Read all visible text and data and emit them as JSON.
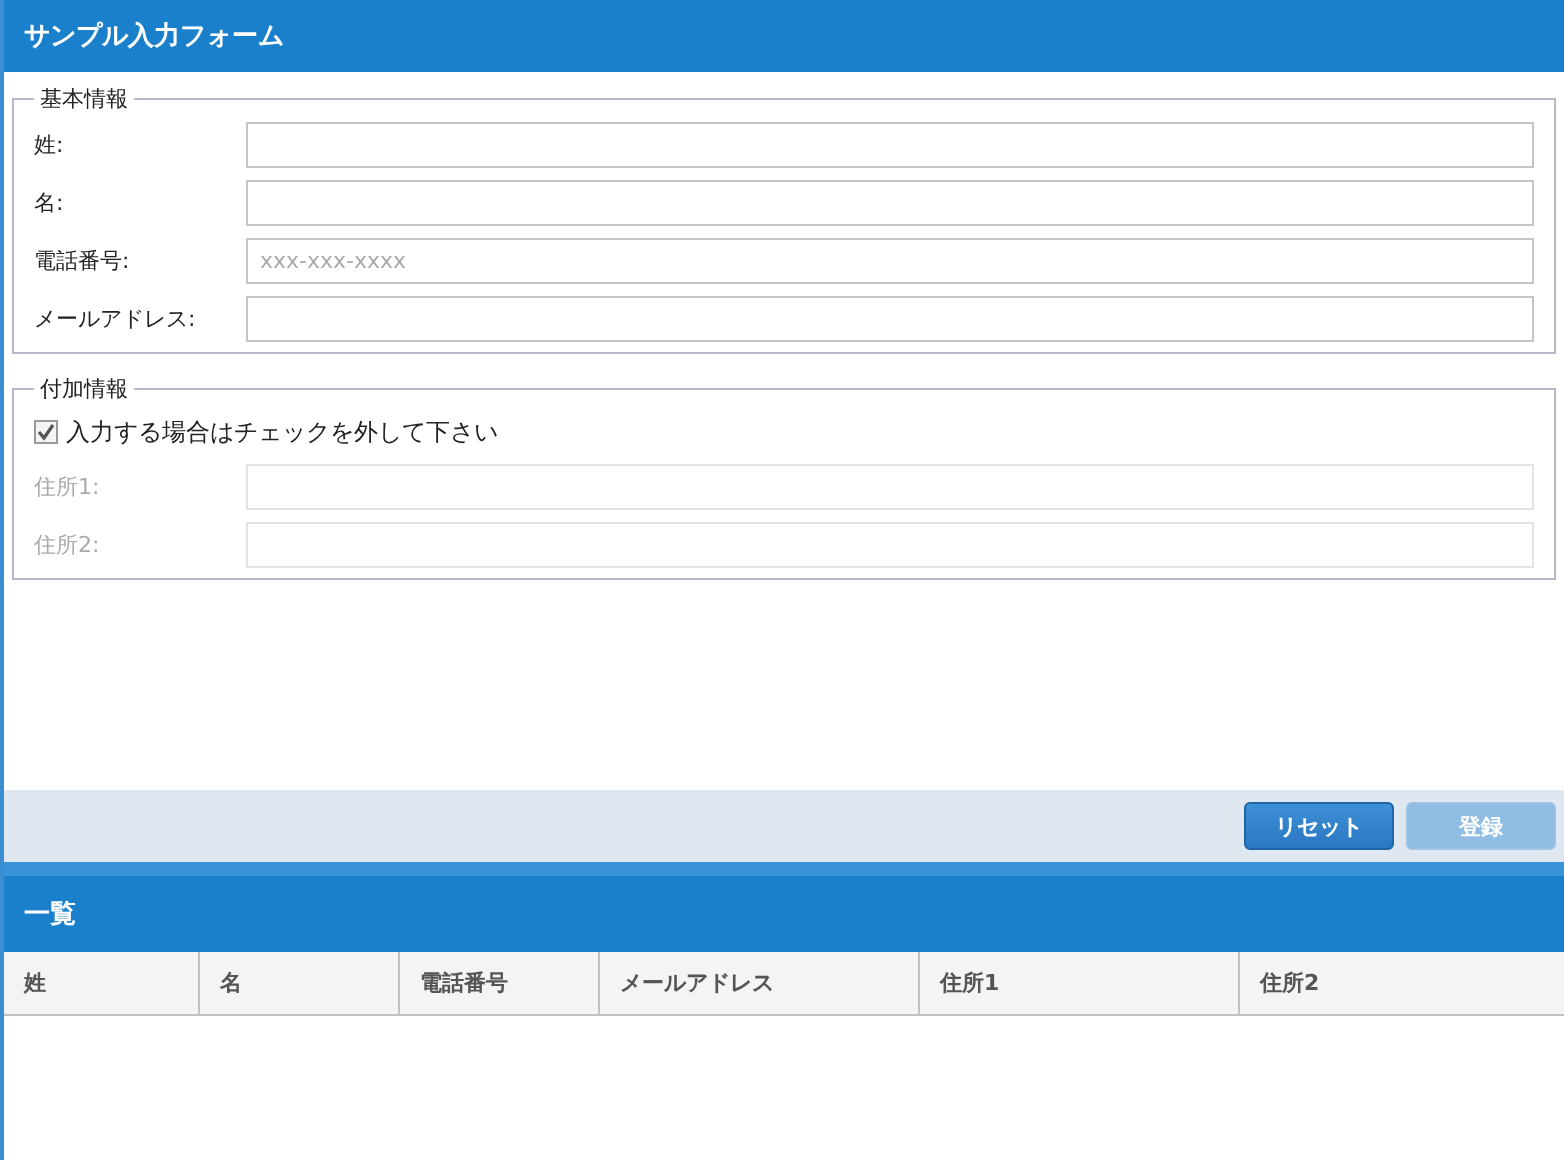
{
  "form": {
    "title": "サンプル入力フォーム"
  },
  "fieldsets": [
    {
      "legend": "基本情報",
      "fields": [
        {
          "label": "姓:",
          "disabled": false
        },
        {
          "label": "名:",
          "disabled": false
        },
        {
          "label": "電話番号:",
          "placeholder": "xxx-xxx-xxxx",
          "disabled": false
        },
        {
          "label": "メールアドレス:",
          "disabled": false
        }
      ]
    },
    {
      "legend": "付加情報",
      "checkbox": {
        "label": "入力する場合はチェックを外して下さい",
        "checked": true
      },
      "fields": [
        {
          "label": "住所1:",
          "disabled": true
        },
        {
          "label": "住所2:",
          "disabled": true
        }
      ]
    }
  ],
  "buttons": [
    {
      "label": "リセット",
      "disabled": false
    },
    {
      "label": "登録",
      "disabled": true
    }
  ],
  "list": {
    "title": "一覧",
    "columns": [
      "姓",
      "名",
      "電話番号",
      "メールアドレス",
      "住所1",
      "住所2"
    ]
  }
}
